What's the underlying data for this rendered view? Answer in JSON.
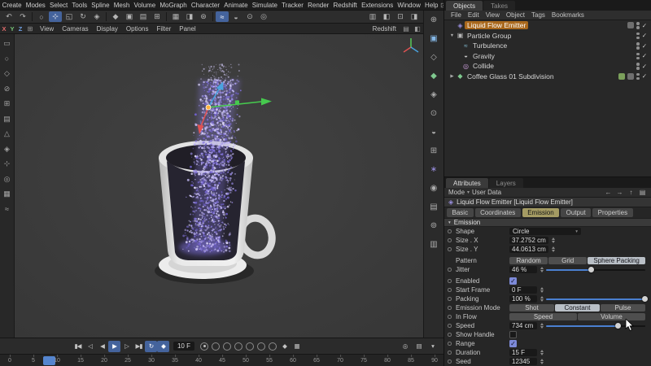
{
  "menubar": {
    "items": [
      "Create",
      "Modes",
      "Select",
      "Tools",
      "Spline",
      "Mesh",
      "Volume",
      "MoGraph",
      "Character",
      "Animate",
      "Simulate",
      "Tracker",
      "Render",
      "Redshift",
      "Extensions",
      "Window",
      "Help"
    ]
  },
  "viewport_menu": {
    "axis_buttons": [
      "X",
      "Y",
      "Z"
    ],
    "items": [
      "View",
      "Cameras",
      "Display",
      "Options",
      "Filter",
      "Panel"
    ],
    "right_item": "Redshift"
  },
  "objects_panel": {
    "tabs": [
      {
        "label": "Objects"
      },
      {
        "label": "Takes"
      }
    ],
    "menu_items": [
      "File",
      "Edit",
      "View",
      "Object",
      "Tags",
      "Bookmarks"
    ],
    "tree": [
      {
        "label": "Liquid Flow Emitter",
        "icon": "◈",
        "expander": ""
      },
      {
        "label": "Particle Group",
        "icon": "▣",
        "expander": "▼"
      },
      {
        "label": "Turbulence",
        "icon": "≈",
        "expander": ""
      },
      {
        "label": "Gravity",
        "icon": "◒",
        "expander": ""
      },
      {
        "label": "Collide",
        "icon": "◎",
        "expander": ""
      },
      {
        "label": "Coffee Glass 01 Subdivision",
        "icon": "◆",
        "expander": "▶"
      }
    ]
  },
  "attributes_panel": {
    "tabs": [
      {
        "label": "Attributes"
      },
      {
        "label": "Layers"
      }
    ],
    "mode_label": "Mode",
    "user_data_label": "User Data",
    "object_title": "Liquid Flow Emitter [Liquid Flow Emitter]",
    "section_tabs": [
      "Basic",
      "Coordinates",
      "Emission",
      "Output",
      "Properties"
    ],
    "active_section_tab": "Emission",
    "section_header": "Emission",
    "rows": {
      "shape": {
        "label": "Shape",
        "value": "Circle"
      },
      "size_x": {
        "label": "Size . X",
        "value": "37.2752 cm"
      },
      "size_y": {
        "label": "Size . Y",
        "value": "44.0613 cm"
      },
      "pattern": {
        "label": "Pattern",
        "options": [
          "Random",
          "Grid",
          "Sphere Packing"
        ],
        "active": "Sphere Packing"
      },
      "jitter": {
        "label": "Jitter",
        "value": "46 %",
        "pct": 46
      },
      "enabled": {
        "label": "Enabled",
        "checked": true
      },
      "start_frame": {
        "label": "Start Frame",
        "value": "0 F"
      },
      "packing": {
        "label": "Packing",
        "value": "100 %",
        "pct": 100
      },
      "emission_mode": {
        "label": "Emission Mode",
        "options": [
          "Shot",
          "Constant",
          "Pulse"
        ],
        "active": "Constant"
      },
      "in_flow": {
        "label": "In Flow",
        "options": [
          "Speed",
          "Volume"
        ]
      },
      "speed": {
        "label": "Speed",
        "value": "734 cm",
        "pct": 73
      },
      "show_handle": {
        "label": "Show Handle",
        "checked": false
      },
      "range": {
        "label": "Range",
        "checked": true
      },
      "duration": {
        "label": "Duration",
        "value": "15 F"
      },
      "seed": {
        "label": "Seed",
        "value": "12345"
      }
    }
  },
  "timeline": {
    "current_frame": "10 F",
    "playhead_frame": 8,
    "ruler_ticks": [
      "0",
      "5",
      "10",
      "15",
      "20",
      "25",
      "30",
      "35",
      "40",
      "45",
      "50",
      "55",
      "60",
      "65",
      "70",
      "75",
      "80",
      "85",
      "90"
    ]
  },
  "icons": {
    "undo": "↶",
    "redo": "↷",
    "live_selection": "○",
    "move": "⊹",
    "scale": "◱",
    "rotate": "↻",
    "last_tool": "◈",
    "model_mode": "◆",
    "object_mode": "▣",
    "texture_mode": "▤",
    "workplane": "⊞",
    "render_view": "▦",
    "render_picture": "◨",
    "render_settings": "⊛",
    "fields": "◒",
    "simulate": "≈",
    "snap": "⊙",
    "magnet": "◎",
    "layout": "▥",
    "panel": "◧",
    "interface": "⊡",
    "more": "⋮",
    "dropdown": "▾",
    "check": "✓",
    "arrow_left": "←",
    "arrow_right": "→",
    "arrow_up": "↑",
    "edit": "▤",
    "transport_start": "▮◀",
    "transport_prev_key": "◁",
    "transport_prev": "◀",
    "transport_play": "▶",
    "transport_next": "▷",
    "transport_end": "▶▮",
    "loop": "↻",
    "keymode": "◆",
    "solo": "◎",
    "options": "▤",
    "emitter": "◈"
  },
  "left_toolbar": [
    {
      "glyph": "▭"
    },
    {
      "glyph": "○"
    },
    {
      "glyph": "◇"
    },
    {
      "glyph": "⊘"
    },
    {
      "glyph": "⊞"
    },
    {
      "glyph": "▤"
    },
    {
      "glyph": "△"
    },
    {
      "glyph": "◈"
    },
    {
      "glyph": "⊹"
    },
    {
      "glyph": "◎"
    },
    {
      "glyph": "▦"
    },
    {
      "glyph": "≈"
    }
  ],
  "right_toolbar": [
    {
      "glyph": "⊕"
    },
    {
      "glyph": "▣"
    },
    {
      "glyph": "◇"
    },
    {
      "glyph": "◆"
    },
    {
      "glyph": "◈"
    },
    {
      "glyph": "⊙"
    },
    {
      "glyph": "◒"
    },
    {
      "glyph": "⊞"
    },
    {
      "glyph": "∗"
    },
    {
      "glyph": "◉"
    },
    {
      "glyph": "▤"
    },
    {
      "glyph": "⊚"
    },
    {
      "glyph": "▥"
    }
  ],
  "colors": {
    "accent_blue": "#4a7fd0",
    "selection_orange": "#a9681c",
    "active_tab_olive": "#a49b63",
    "particle_purple": "#8f83dd"
  }
}
